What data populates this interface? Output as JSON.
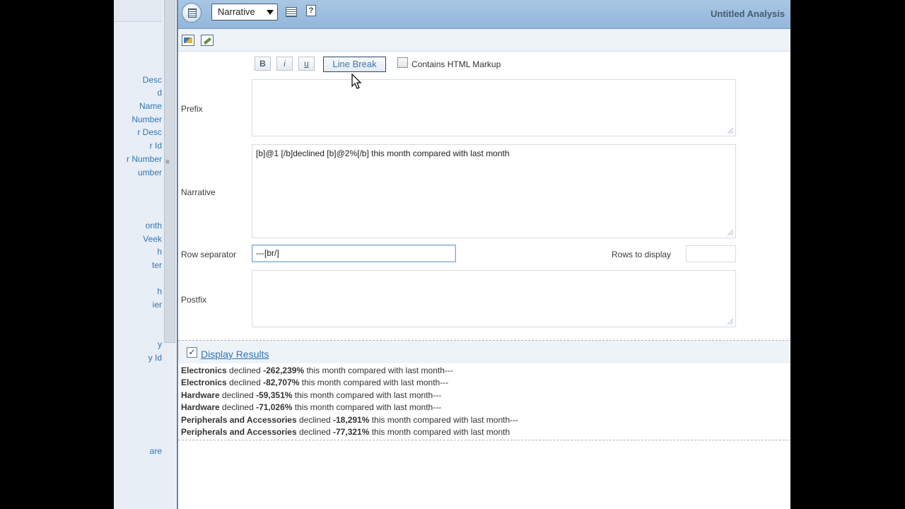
{
  "left_pane": {
    "items": [
      {
        "label": "Desc"
      },
      {
        "label": "d"
      },
      {
        "label": "Name"
      },
      {
        "label": "Number"
      },
      {
        "label": "r Desc"
      },
      {
        "label": "r Id"
      },
      {
        "label": "r Number"
      },
      {
        "label": "umber"
      },
      {
        "label": "onth"
      },
      {
        "label": "Veek"
      },
      {
        "label": "h"
      },
      {
        "label": "ter"
      },
      {
        "label": "h"
      },
      {
        "label": "ier"
      },
      {
        "label": "y"
      },
      {
        "label": "y Id"
      },
      {
        "label": "are"
      }
    ]
  },
  "header": {
    "view_type": "Narrative",
    "analysis_title": "Untitled Analysis"
  },
  "format_toolbar": {
    "bold_label": "B",
    "italic_label": "i",
    "underline_label": "u",
    "line_break_label": "Line Break",
    "contains_html_label": "Contains HTML Markup",
    "contains_html_checked": false
  },
  "form": {
    "prefix_label": "Prefix",
    "prefix_value": "",
    "narrative_label": "Narrative",
    "narrative_value": "[b]@1 [/b]declined [b]@2%[/b] this month compared with last month",
    "row_separator_label": "Row separator",
    "row_separator_value": "---[br/]",
    "rows_to_display_label": "Rows to display",
    "rows_to_display_value": "",
    "postfix_label": "Postfix",
    "postfix_value": ""
  },
  "results": {
    "display_results_label": "Display Results",
    "display_results_checked": true,
    "lines": [
      {
        "name": "Electronics",
        "mid": " declined ",
        "pct": "-262,239%",
        "rest": " this month compared with last month---"
      },
      {
        "name": "Electronics",
        "mid": " declined ",
        "pct": "-82,707%",
        "rest": " this month compared with last month---"
      },
      {
        "name": "Hardware",
        "mid": " declined ",
        "pct": "-59,351%",
        "rest": " this month compared with last month---"
      },
      {
        "name": "Hardware",
        "mid": " declined ",
        "pct": "-71,026%",
        "rest": " this month compared with last month---"
      },
      {
        "name": "Peripherals and Accessories",
        "mid": " declined ",
        "pct": "-18,291%",
        "rest": " this month compared with last month---"
      },
      {
        "name": "Peripherals and Accessories",
        "mid": " declined ",
        "pct": "-77,321%",
        "rest": " this month compared with last month"
      }
    ]
  },
  "colors": {
    "header_bg": "#a9c7e4",
    "link": "#2f74b5",
    "accent_button": "#3e77ac"
  }
}
